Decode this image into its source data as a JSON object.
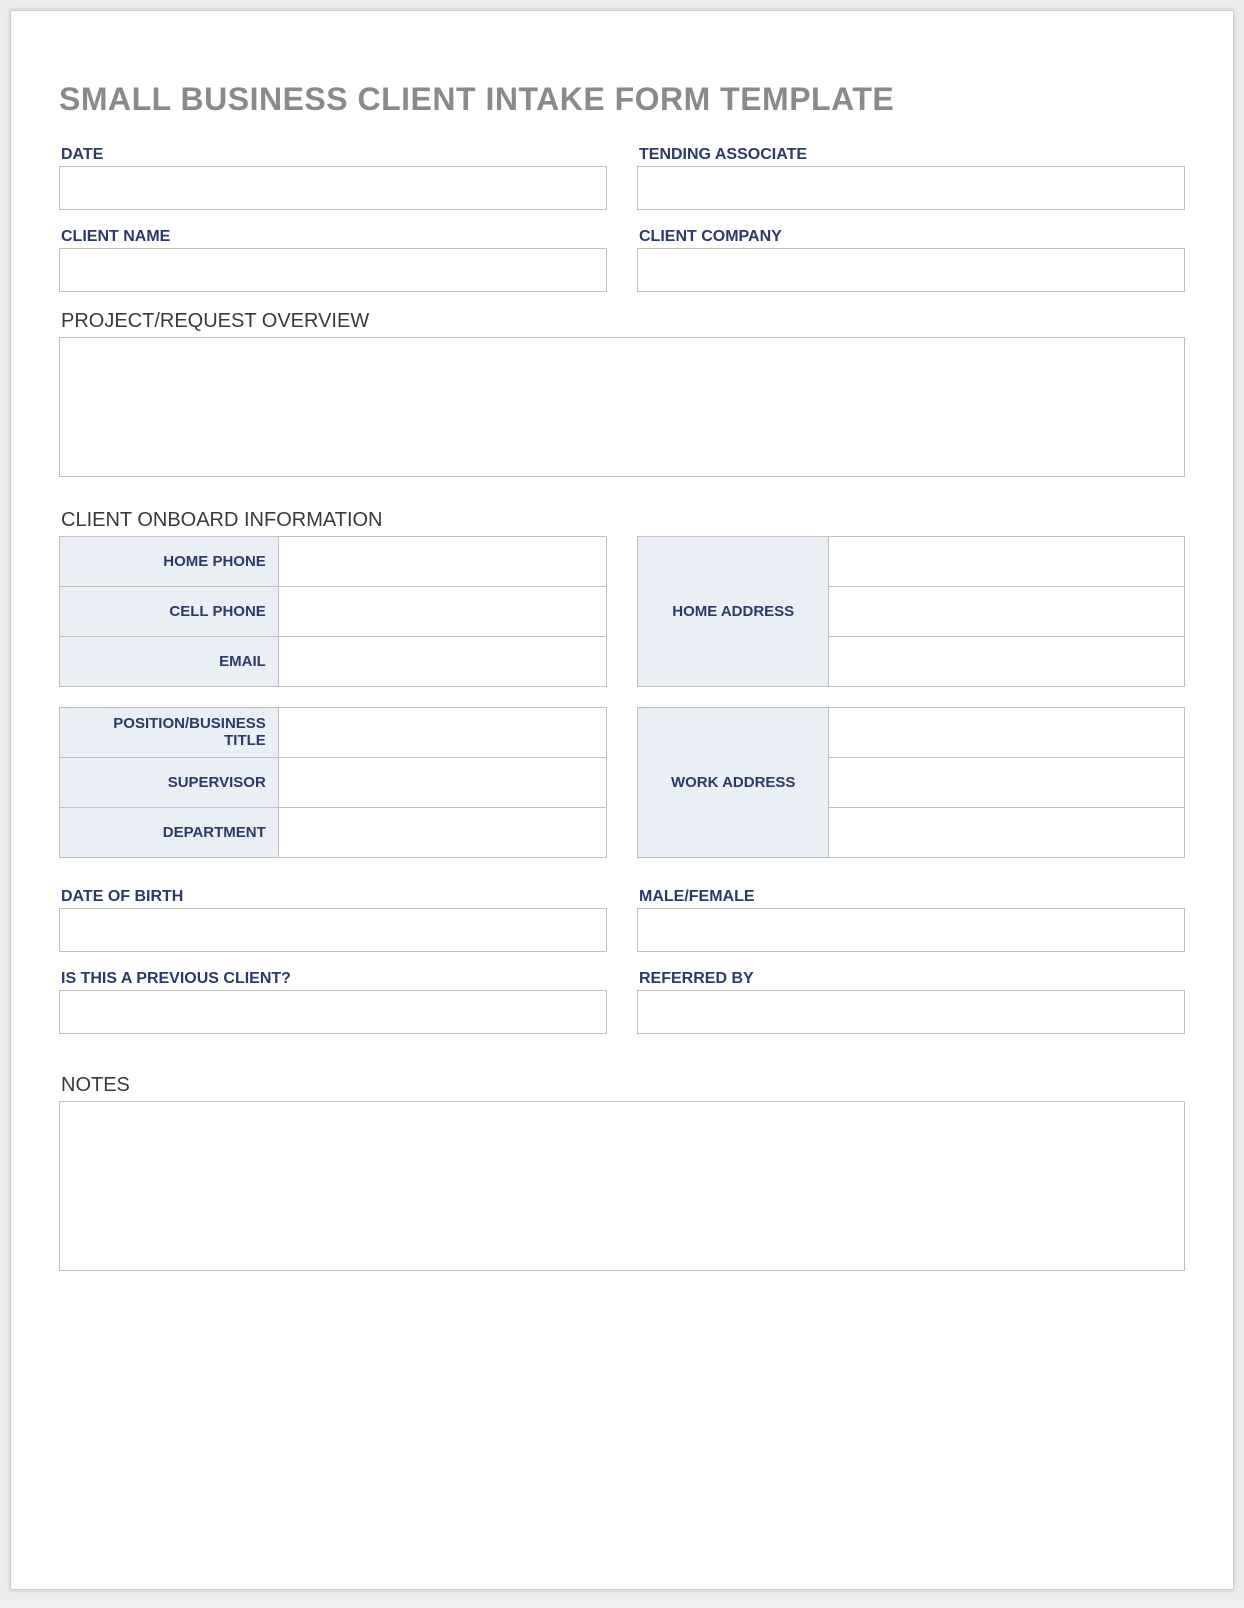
{
  "title": "SMALL BUSINESS CLIENT INTAKE FORM TEMPLATE",
  "top": {
    "date_label": "DATE",
    "date_value": "",
    "associate_label": "TENDING ASSOCIATE",
    "associate_value": "",
    "client_name_label": "CLIENT NAME",
    "client_name_value": "",
    "client_company_label": "CLIENT COMPANY",
    "client_company_value": ""
  },
  "project": {
    "section_label": "PROJECT/REQUEST OVERVIEW",
    "value": ""
  },
  "onboard": {
    "section_label": "CLIENT ONBOARD INFORMATION",
    "block1": {
      "home_phone_label": "HOME PHONE",
      "home_phone_value": "",
      "cell_phone_label": "CELL PHONE",
      "cell_phone_value": "",
      "email_label": "EMAIL",
      "email_value": "",
      "home_address_label": "HOME ADDRESS",
      "home_address_line1": "",
      "home_address_line2": "",
      "home_address_line3": ""
    },
    "block2": {
      "position_label": "POSITION/BUSINESS TITLE",
      "position_value": "",
      "supervisor_label": "SUPERVISOR",
      "supervisor_value": "",
      "department_label": "DEPARTMENT",
      "department_value": "",
      "work_address_label": "WORK ADDRESS",
      "work_address_line1": "",
      "work_address_line2": "",
      "work_address_line3": ""
    }
  },
  "extra": {
    "dob_label": "DATE OF BIRTH",
    "dob_value": "",
    "gender_label": "MALE/FEMALE",
    "gender_value": "",
    "prev_client_label": "IS THIS A PREVIOUS CLIENT?",
    "prev_client_value": "",
    "referred_label": "REFERRED BY",
    "referred_value": ""
  },
  "notes": {
    "section_label": "NOTES",
    "value": ""
  }
}
